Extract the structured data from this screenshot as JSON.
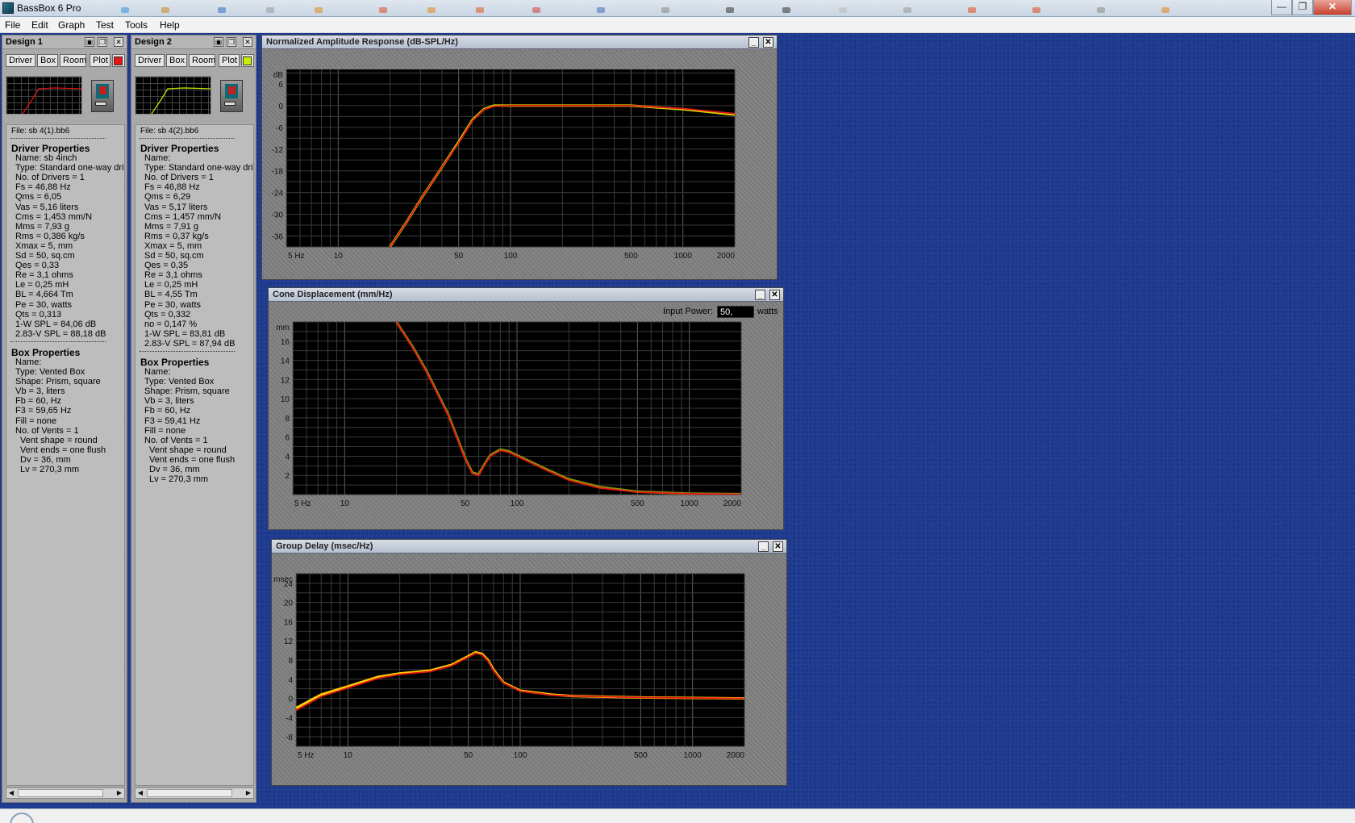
{
  "app": {
    "title": "BassBox 6 Pro"
  },
  "window_buttons": {
    "minimize": "—",
    "maximize": "❐",
    "close": "✕"
  },
  "menu": [
    "File",
    "Edit",
    "Graph",
    "Test",
    "Tools",
    "Help"
  ],
  "designs": [
    {
      "name": "Design 1",
      "tabs": [
        "Driver",
        "Box",
        "Room",
        "Plot"
      ],
      "plot_color": "#e51616",
      "file": "File: sb 4(1).bb6",
      "driver_heading": "Driver Properties",
      "driver": [
        "Name: sb 4inch",
        "Type: Standard one-way driv",
        "No. of Drivers = 1",
        "Fs = 46,88 Hz",
        "Qms = 6,05",
        "Vas = 5,16 liters",
        "Cms = 1,453 mm/N",
        "Mms = 7,93 g",
        "Rms = 0,386 kg/s",
        "Xmax = 5, mm",
        "Sd = 50, sq.cm",
        "Qes = 0,33",
        "Re = 3,1 ohms",
        "Le = 0,25 mH",
        "BL = 4,664 Tm",
        "Pe = 30, watts",
        "Qts = 0,313",
        "1-W SPL = 84,06 dB",
        "2.83-V SPL = 88,18 dB"
      ],
      "box_heading": "Box Properties",
      "box": [
        "Name:",
        "Type: Vented Box",
        "Shape: Prism, square",
        "Vb = 3, liters",
        "Fb = 60, Hz",
        "F3 = 59,65 Hz",
        "Fill = none",
        "No. of Vents = 1",
        "Vent shape = round",
        "Vent ends = one flush",
        "Dv = 36, mm",
        "Lv = 270,3 mm"
      ]
    },
    {
      "name": "Design 2",
      "tabs": [
        "Driver",
        "Box",
        "Room",
        "Plot"
      ],
      "plot_color": "#c8f000",
      "file": "File: sb 4(2).bb6",
      "driver_heading": "Driver Properties",
      "driver": [
        "Name:",
        "Type: Standard one-way driv",
        "No. of Drivers = 1",
        "Fs = 46,88 Hz",
        "Qms = 6,29",
        "Vas = 5,17 liters",
        "Cms = 1,457 mm/N",
        "Mms = 7,91 g",
        "Rms = 0,37 kg/s",
        "Xmax = 5, mm",
        "Sd = 50, sq.cm",
        "Qes = 0,35",
        "Re = 3,1 ohms",
        "Le = 0,25 mH",
        "BL = 4,55 Tm",
        "Pe = 30, watts",
        "Qts = 0,332",
        "no = 0,147 %",
        "1-W SPL = 83,81 dB",
        "2.83-V SPL = 87,94 dB"
      ],
      "box_heading": "Box Properties",
      "box": [
        "Name:",
        "Type: Vented Box",
        "Shape: Prism, square",
        "Vb = 3, liters",
        "Fb = 60, Hz",
        "F3 = 59,41 Hz",
        "Fill = none",
        "No. of Vents = 1",
        "Vent shape = round",
        "Vent ends = one flush",
        "Dv = 36, mm",
        "Lv = 270,3 mm"
      ]
    }
  ],
  "graphs": [
    {
      "title": "Normalized Amplitude Response (dB-SPL/Hz)",
      "chart_data": {
        "type": "line",
        "ylabel": "dB",
        "y_ticks": [
          6,
          0,
          -6,
          -12,
          -18,
          -24,
          -30,
          -36
        ],
        "ylim": [
          -39,
          10
        ],
        "xlim": [
          5,
          2000
        ],
        "x_scale": "log",
        "x_tick_labels": [
          "5 Hz",
          "10",
          "50",
          "100",
          "500",
          "1000",
          "2000"
        ],
        "grid": true,
        "series": [
          {
            "color": "#d4d400",
            "x": [
              20,
              25,
              30,
              40,
              50,
              60,
              70,
              80,
              100,
              150,
              200,
              500,
              1000,
              2000
            ],
            "y": [
              -39,
              -32,
              -26,
              -17,
              -10,
              -4,
              -1,
              0,
              0,
              0,
              0,
              0,
              -1,
              -2.5
            ]
          },
          {
            "color": "#e51616",
            "x": [
              20,
              25,
              30,
              40,
              50,
              60,
              70,
              80,
              100,
              150,
              200,
              500,
              1000,
              2000
            ],
            "y": [
              -39,
              -32,
              -26,
              -17,
              -10.3,
              -4.2,
              -1.1,
              -0.2,
              0,
              0,
              0,
              0,
              -0.8,
              -2.2
            ]
          }
        ]
      }
    },
    {
      "title": "Cone Displacement (mm/Hz)",
      "input_power_label": "Input Power:",
      "input_power_value": "50,",
      "input_power_unit": "watts",
      "chart_data": {
        "type": "line",
        "ylabel": "mm",
        "y_ticks": [
          16,
          14,
          12,
          10,
          8,
          6,
          4,
          2
        ],
        "ylim": [
          0,
          18
        ],
        "xlim": [
          5,
          2000
        ],
        "x_scale": "log",
        "x_tick_labels": [
          "5 Hz",
          "10",
          "50",
          "100",
          "500",
          "1000",
          "2000"
        ],
        "grid": true,
        "series": [
          {
            "color": "#8a9a00",
            "x": [
              20,
              25,
              30,
              40,
              50,
              55,
              60,
              65,
              70,
              80,
              90,
              100,
              150,
              200,
              300,
              500,
              1000,
              2000
            ],
            "y": [
              18,
              15.3,
              12.8,
              8.3,
              3.8,
              2.3,
              2.1,
              3.2,
              4.1,
              4.7,
              4.5,
              4.1,
              2.6,
              1.6,
              0.8,
              0.3,
              0.1,
              0.05
            ]
          },
          {
            "color": "#e51616",
            "x": [
              20,
              25,
              30,
              40,
              50,
              55,
              60,
              65,
              70,
              80,
              90,
              100,
              150,
              200,
              300,
              500,
              1000,
              2000
            ],
            "y": [
              18,
              15.2,
              12.7,
              8.2,
              3.7,
              2.2,
              2.0,
              3.1,
              4.0,
              4.6,
              4.4,
              4.0,
              2.5,
              1.5,
              0.7,
              0.25,
              0.08,
              0.03
            ]
          }
        ]
      }
    },
    {
      "title": "Group Delay (msec/Hz)",
      "chart_data": {
        "type": "line",
        "ylabel": "msec",
        "y_ticks": [
          24,
          20,
          16,
          12,
          8,
          4,
          0,
          -4,
          -8
        ],
        "ylim": [
          -10,
          26
        ],
        "xlim": [
          5,
          2000
        ],
        "x_scale": "log",
        "x_tick_labels": [
          "5 Hz",
          "10",
          "50",
          "100",
          "500",
          "1000",
          "2000"
        ],
        "grid": true,
        "series": [
          {
            "color": "#ffd000",
            "x": [
              5,
              7,
              10,
              15,
              20,
              30,
              40,
              50,
              55,
              60,
              65,
              70,
              80,
              100,
              150,
              200,
              500,
              1000,
              2000
            ],
            "y": [
              -2,
              0.8,
              2.5,
              4.5,
              5.2,
              5.8,
              7,
              8.8,
              9.6,
              9.3,
              8,
              6,
              3.3,
              1.6,
              0.8,
              0.5,
              0.2,
              0.1,
              0
            ]
          },
          {
            "color": "#e51616",
            "x": [
              5,
              7,
              10,
              15,
              20,
              30,
              40,
              50,
              55,
              60,
              65,
              70,
              80,
              100,
              150,
              200,
              500,
              1000,
              2000
            ],
            "y": [
              -2.5,
              0.4,
              2.2,
              4.2,
              5,
              5.6,
              6.8,
              8.6,
              9.4,
              9.1,
              7.8,
              5.8,
              3.2,
              1.5,
              0.7,
              0.5,
              0.2,
              0.1,
              0
            ]
          }
        ]
      }
    }
  ]
}
